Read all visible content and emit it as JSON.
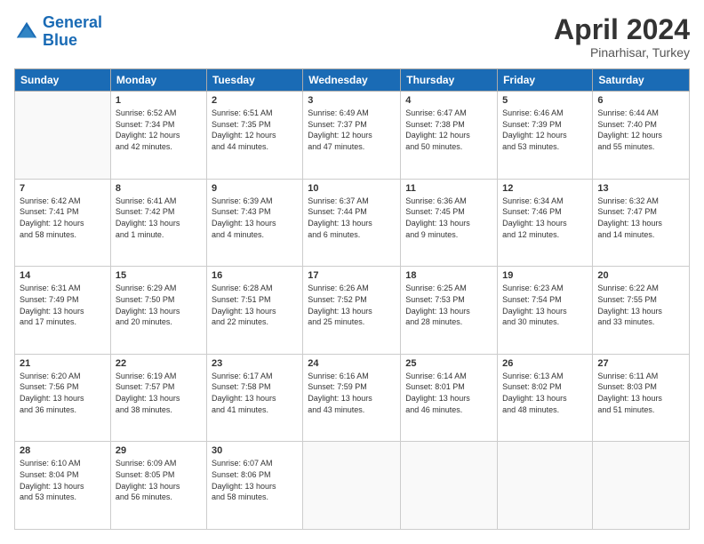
{
  "header": {
    "logo_line1": "General",
    "logo_line2": "Blue",
    "month": "April 2024",
    "location": "Pinarhisar, Turkey"
  },
  "weekdays": [
    "Sunday",
    "Monday",
    "Tuesday",
    "Wednesday",
    "Thursday",
    "Friday",
    "Saturday"
  ],
  "weeks": [
    [
      {
        "day": "",
        "info": ""
      },
      {
        "day": "1",
        "info": "Sunrise: 6:52 AM\nSunset: 7:34 PM\nDaylight: 12 hours\nand 42 minutes."
      },
      {
        "day": "2",
        "info": "Sunrise: 6:51 AM\nSunset: 7:35 PM\nDaylight: 12 hours\nand 44 minutes."
      },
      {
        "day": "3",
        "info": "Sunrise: 6:49 AM\nSunset: 7:37 PM\nDaylight: 12 hours\nand 47 minutes."
      },
      {
        "day": "4",
        "info": "Sunrise: 6:47 AM\nSunset: 7:38 PM\nDaylight: 12 hours\nand 50 minutes."
      },
      {
        "day": "5",
        "info": "Sunrise: 6:46 AM\nSunset: 7:39 PM\nDaylight: 12 hours\nand 53 minutes."
      },
      {
        "day": "6",
        "info": "Sunrise: 6:44 AM\nSunset: 7:40 PM\nDaylight: 12 hours\nand 55 minutes."
      }
    ],
    [
      {
        "day": "7",
        "info": "Sunrise: 6:42 AM\nSunset: 7:41 PM\nDaylight: 12 hours\nand 58 minutes."
      },
      {
        "day": "8",
        "info": "Sunrise: 6:41 AM\nSunset: 7:42 PM\nDaylight: 13 hours\nand 1 minute."
      },
      {
        "day": "9",
        "info": "Sunrise: 6:39 AM\nSunset: 7:43 PM\nDaylight: 13 hours\nand 4 minutes."
      },
      {
        "day": "10",
        "info": "Sunrise: 6:37 AM\nSunset: 7:44 PM\nDaylight: 13 hours\nand 6 minutes."
      },
      {
        "day": "11",
        "info": "Sunrise: 6:36 AM\nSunset: 7:45 PM\nDaylight: 13 hours\nand 9 minutes."
      },
      {
        "day": "12",
        "info": "Sunrise: 6:34 AM\nSunset: 7:46 PM\nDaylight: 13 hours\nand 12 minutes."
      },
      {
        "day": "13",
        "info": "Sunrise: 6:32 AM\nSunset: 7:47 PM\nDaylight: 13 hours\nand 14 minutes."
      }
    ],
    [
      {
        "day": "14",
        "info": "Sunrise: 6:31 AM\nSunset: 7:49 PM\nDaylight: 13 hours\nand 17 minutes."
      },
      {
        "day": "15",
        "info": "Sunrise: 6:29 AM\nSunset: 7:50 PM\nDaylight: 13 hours\nand 20 minutes."
      },
      {
        "day": "16",
        "info": "Sunrise: 6:28 AM\nSunset: 7:51 PM\nDaylight: 13 hours\nand 22 minutes."
      },
      {
        "day": "17",
        "info": "Sunrise: 6:26 AM\nSunset: 7:52 PM\nDaylight: 13 hours\nand 25 minutes."
      },
      {
        "day": "18",
        "info": "Sunrise: 6:25 AM\nSunset: 7:53 PM\nDaylight: 13 hours\nand 28 minutes."
      },
      {
        "day": "19",
        "info": "Sunrise: 6:23 AM\nSunset: 7:54 PM\nDaylight: 13 hours\nand 30 minutes."
      },
      {
        "day": "20",
        "info": "Sunrise: 6:22 AM\nSunset: 7:55 PM\nDaylight: 13 hours\nand 33 minutes."
      }
    ],
    [
      {
        "day": "21",
        "info": "Sunrise: 6:20 AM\nSunset: 7:56 PM\nDaylight: 13 hours\nand 36 minutes."
      },
      {
        "day": "22",
        "info": "Sunrise: 6:19 AM\nSunset: 7:57 PM\nDaylight: 13 hours\nand 38 minutes."
      },
      {
        "day": "23",
        "info": "Sunrise: 6:17 AM\nSunset: 7:58 PM\nDaylight: 13 hours\nand 41 minutes."
      },
      {
        "day": "24",
        "info": "Sunrise: 6:16 AM\nSunset: 7:59 PM\nDaylight: 13 hours\nand 43 minutes."
      },
      {
        "day": "25",
        "info": "Sunrise: 6:14 AM\nSunset: 8:01 PM\nDaylight: 13 hours\nand 46 minutes."
      },
      {
        "day": "26",
        "info": "Sunrise: 6:13 AM\nSunset: 8:02 PM\nDaylight: 13 hours\nand 48 minutes."
      },
      {
        "day": "27",
        "info": "Sunrise: 6:11 AM\nSunset: 8:03 PM\nDaylight: 13 hours\nand 51 minutes."
      }
    ],
    [
      {
        "day": "28",
        "info": "Sunrise: 6:10 AM\nSunset: 8:04 PM\nDaylight: 13 hours\nand 53 minutes."
      },
      {
        "day": "29",
        "info": "Sunrise: 6:09 AM\nSunset: 8:05 PM\nDaylight: 13 hours\nand 56 minutes."
      },
      {
        "day": "30",
        "info": "Sunrise: 6:07 AM\nSunset: 8:06 PM\nDaylight: 13 hours\nand 58 minutes."
      },
      {
        "day": "",
        "info": ""
      },
      {
        "day": "",
        "info": ""
      },
      {
        "day": "",
        "info": ""
      },
      {
        "day": "",
        "info": ""
      }
    ]
  ]
}
